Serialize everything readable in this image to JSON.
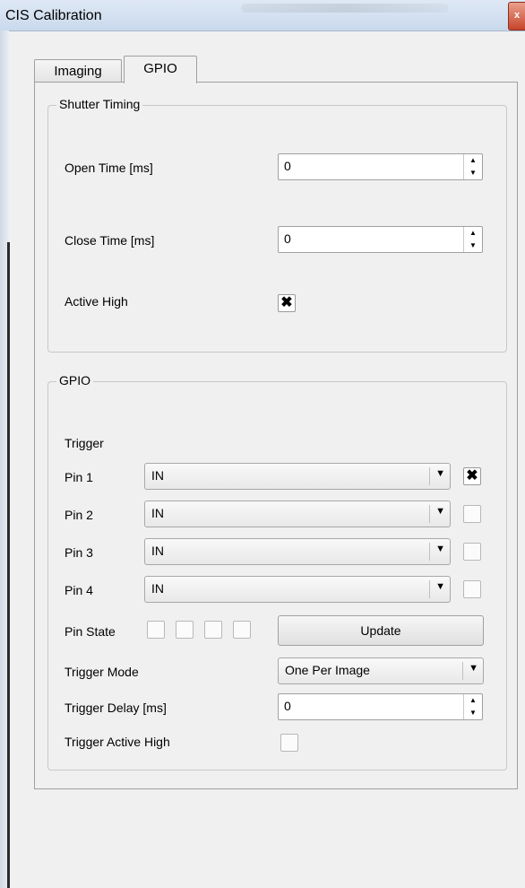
{
  "window": {
    "title": "CIS Calibration",
    "close_glyph": "x"
  },
  "tabs": [
    {
      "label": "Imaging"
    },
    {
      "label": "GPIO"
    }
  ],
  "shutter": {
    "title": "Shutter Timing",
    "open_time": {
      "label": "Open Time [ms]",
      "value": "0"
    },
    "close_time": {
      "label": "Close Time [ms]",
      "value": "0"
    },
    "active_high": {
      "label": "Active High",
      "checked": true
    }
  },
  "gpio": {
    "title": "GPIO",
    "trigger_label": "Trigger",
    "pins": [
      {
        "label": "Pin 1",
        "value": "IN",
        "checked": true
      },
      {
        "label": "Pin 2",
        "value": "IN",
        "checked": false
      },
      {
        "label": "Pin 3",
        "value": "IN",
        "checked": false
      },
      {
        "label": "Pin 4",
        "value": "IN",
        "checked": false
      }
    ],
    "pin_state": {
      "label": "Pin State",
      "states": [
        false,
        false,
        false,
        false
      ]
    },
    "update_label": "Update",
    "trigger_mode": {
      "label": "Trigger Mode",
      "value": "One Per Image"
    },
    "trigger_delay": {
      "label": "Trigger Delay [ms]",
      "value": "0"
    },
    "trigger_active_high": {
      "label": "Trigger Active High",
      "checked": false
    }
  },
  "icons": {
    "spin_up": "▲",
    "spin_down": "▼",
    "combo_arrow": "▼",
    "check_mark": "✖"
  }
}
